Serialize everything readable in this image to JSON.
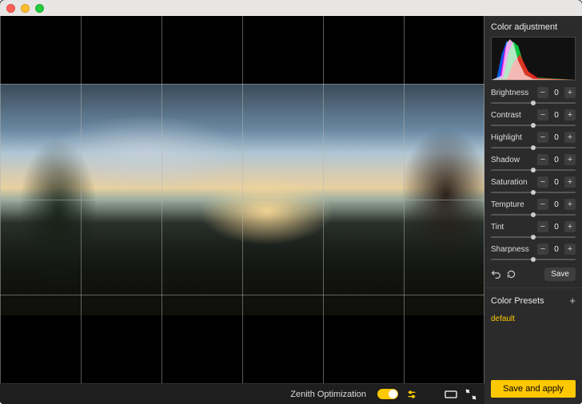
{
  "panel": {
    "header": "Color adjustment",
    "sliders": [
      {
        "label": "Brightness",
        "value": "0"
      },
      {
        "label": "Contrast",
        "value": "0"
      },
      {
        "label": "Highlight",
        "value": "0"
      },
      {
        "label": "Shadow",
        "value": "0"
      },
      {
        "label": "Saturation",
        "value": "0"
      },
      {
        "label": "Tempture",
        "value": "0"
      },
      {
        "label": "Tint",
        "value": "0"
      },
      {
        "label": "Sharpness",
        "value": "0"
      }
    ],
    "save_label": "Save",
    "presets_header": "Color Presets",
    "preset_default": "default",
    "save_apply": "Save and apply",
    "minus": "−",
    "plus": "+"
  },
  "footer": {
    "zenith_label": "Zenith Optimization"
  }
}
